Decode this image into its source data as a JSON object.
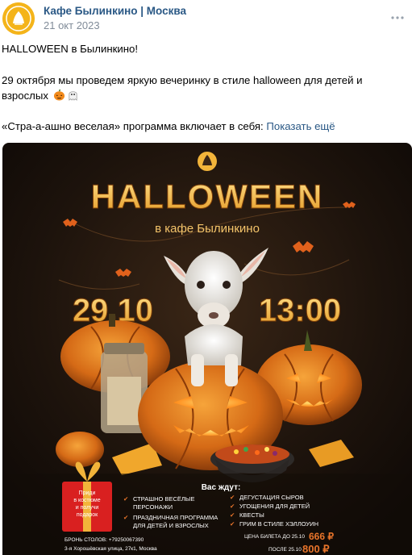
{
  "post": {
    "author": "Кафе Былинкино | Москва",
    "date": "21 окт 2023",
    "line1": "HALLOWEEN в Былинкино!",
    "line2a": "29 октября мы проведем яркую вечеринку в стиле halloween для детей и",
    "line2b": "взрослых",
    "line3": "«Стра-а-ашно веселая» программа включает в себя:",
    "show_more": "Показать ещё",
    "more_icon": "more-horizontal-icon"
  },
  "poster": {
    "title": "HALLOWEEN",
    "subtitle": "в кафе Былинкино",
    "date": "29.10",
    "time": "13:00",
    "awaits": "Вас ждут:",
    "left_items": [
      [
        "СТРАШНО ВЕСЁЛЫЕ",
        "ПЕРСОНАЖИ"
      ],
      [
        "ПРАЗДНИЧНАЯ ПРОГРАММА",
        "ДЛЯ ДЕТЕЙ И ВЗРОСЛЫХ"
      ]
    ],
    "right_items": [
      "ДЕГУСТАЦИЯ СЫРОВ",
      "УГОЩЕНИЯ ДЛЯ ДЕТЕЙ",
      "КВЕСТЫ",
      "ГРИМ В СТИЛЕ ХЭЛЛОУИН"
    ],
    "gift_text": [
      "Приди",
      "в костюме",
      "и получи",
      "подарок"
    ],
    "booking": "БРОНЬ СТОЛОВ: +79250067390",
    "address": "3-я Хорошёвская улица, 27к1, Москва",
    "price_before_label": "ЦЕНА БИЛЕТА ДО 25.10",
    "price_before": "666 ₽",
    "price_after_label": "ПОСЛЕ 25.10",
    "price_after": "800 ₽",
    "colors": {
      "gold": "#f2b43a",
      "orange": "#e8742a",
      "bg": "#1c130d"
    }
  }
}
